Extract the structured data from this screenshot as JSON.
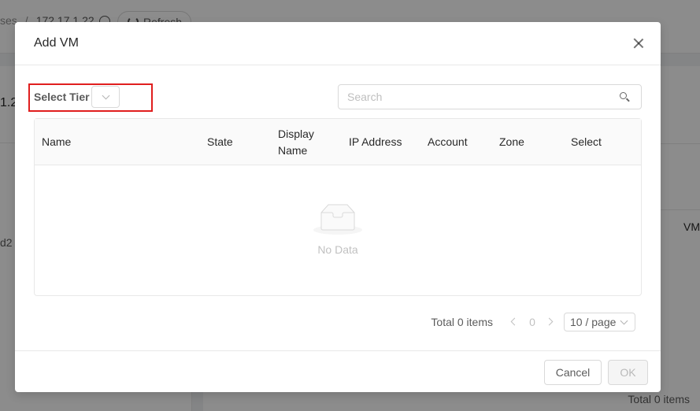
{
  "background": {
    "breadcrumb_prev": "ses",
    "breadcrumb_sep": "/",
    "breadcrumb_ip": "172.17.1.22",
    "refresh_label": "Refresh",
    "left_value_1": "1.2",
    "left_value_2": "d2",
    "right_col": "VM",
    "right_total": "Total 0 items"
  },
  "modal": {
    "title": "Add VM",
    "tier_label": "Select Tier",
    "search_placeholder": "Search",
    "columns": [
      "Name",
      "State",
      "Display Name",
      "IP Address",
      "Account",
      "Zone",
      "Select"
    ],
    "empty_text": "No Data",
    "pagination": {
      "total": "Total 0 items",
      "current_page": "0",
      "page_size": "10 / page"
    },
    "footer": {
      "cancel": "Cancel",
      "ok": "OK"
    }
  },
  "colors": {
    "highlight": "#e01e1e",
    "border": "#d9d9d9"
  }
}
